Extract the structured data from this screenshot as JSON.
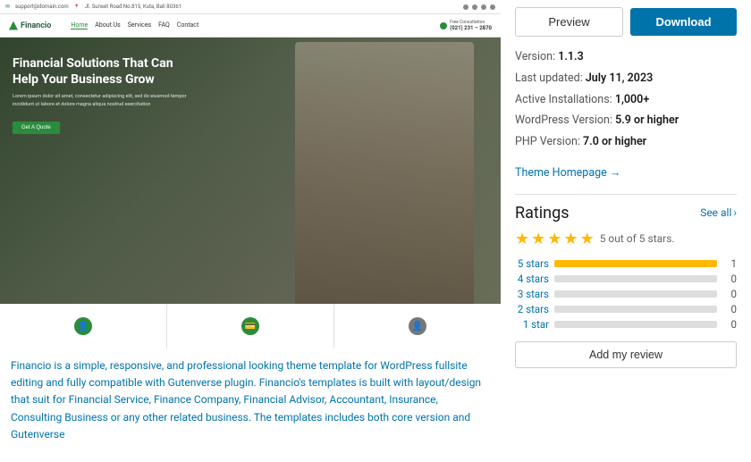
{
  "header": {
    "preview_label": "Preview",
    "download_label": "Download"
  },
  "meta": {
    "version_label": "Version:",
    "version_value": "1.1.3",
    "last_updated_label": "Last updated:",
    "last_updated_value": "July 11, 2023",
    "active_installs_label": "Active Installations:",
    "active_installs_value": "1,000+",
    "wp_version_label": "WordPress Version:",
    "wp_version_value": "5.9 or higher",
    "php_version_label": "PHP Version:",
    "php_version_value": "7.0 or higher",
    "theme_homepage_label": "Theme Homepage →"
  },
  "fake_site": {
    "topbar_email": "support@domain.com",
    "topbar_address": "Jl. Sunset Road No.815, Kuta, Bali 80361",
    "logo_text": "Financio",
    "nav_links": [
      "Home",
      "About Us",
      "Services",
      "FAQ",
      "Contact"
    ],
    "free_consultation": "Free Consultation",
    "phone": "(021) 231 – 2870",
    "hero_title": "Financial Solutions That Can Help Your Business Grow",
    "hero_subtitle": "Lorem ipsum dolor sit amet, consectetur adipiscing elit, sed do eiusmod tempor incididunt ut labore et dolore magna aliqua nostrud exercitation",
    "hero_btn": "Get A Quote"
  },
  "description": {
    "text": "Financio is a simple, responsive, and professional looking theme template for WordPress fullsite editing and fully compatible with Gutenverse plugin. Financio's templates is built with layout/design that suit for Financial Service, Finance Company, Financial Advisor, Accountant, Insurance, Consulting Business or any other related business. The templates includes both core version and Gutenverse"
  },
  "ratings": {
    "title": "Ratings",
    "see_all": "See all",
    "chevron": "›",
    "summary": "5 out of 5 stars.",
    "stars": [
      1,
      2,
      3,
      4,
      5
    ],
    "bars": [
      {
        "label": "5 stars",
        "fill_percent": 100,
        "count": 1
      },
      {
        "label": "4 stars",
        "fill_percent": 0,
        "count": 0
      },
      {
        "label": "3 stars",
        "fill_percent": 0,
        "count": 0
      },
      {
        "label": "2 stars",
        "fill_percent": 0,
        "count": 0
      },
      {
        "label": "1 star",
        "fill_percent": 0,
        "count": 0
      }
    ],
    "add_review_label": "Add my review"
  },
  "colors": {
    "accent": "#0073aa",
    "star": "#ffb900",
    "green": "#2a8c3c",
    "download_bg": "#0073aa"
  }
}
